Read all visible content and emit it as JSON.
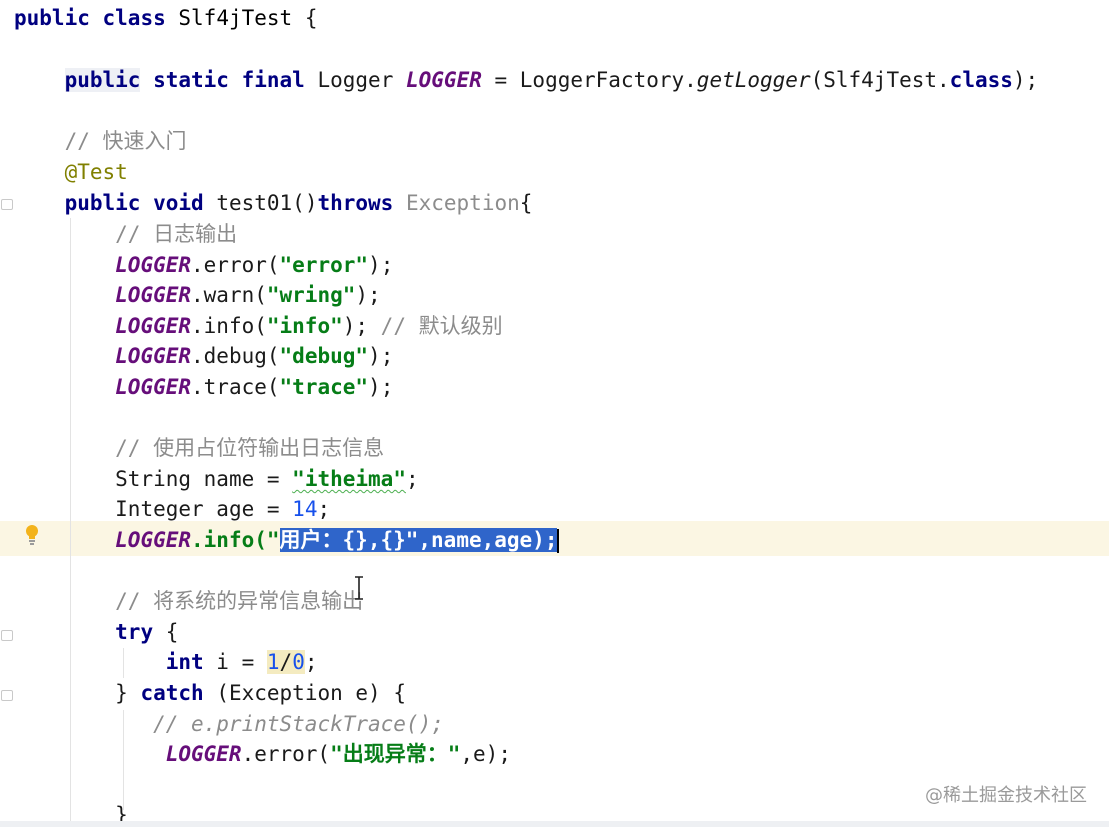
{
  "editor": {
    "class_decl": {
      "kw1": "public",
      "kw2": "class",
      "name": "Slf4jTest",
      "brace": " {"
    },
    "logger_decl": {
      "kw_public": "public",
      "kw_static": "static",
      "kw_final": "final",
      "type": "Logger",
      "field": "LOGGER",
      "assign": " = LoggerFactory.",
      "method": "getLogger",
      "args_open": "(Slf4jTest.",
      "kw_class": "class",
      "args_close": ");"
    },
    "comment_quickstart": "// 快速入门",
    "annotation": "@Test",
    "method_decl": {
      "kw_public": "public",
      "kw_void": "void",
      "name": " test01()",
      "kw_throws": "throws",
      "exception": " Exception",
      "brace": "{"
    },
    "comment_log_output": "// 日志输出",
    "log_calls": [
      {
        "field": "LOGGER",
        "call": ".error(",
        "arg": "\"error\"",
        "end": ");",
        "comment": ""
      },
      {
        "field": "LOGGER",
        "call": ".warn(",
        "arg": "\"wring\"",
        "end": ");",
        "comment": ""
      },
      {
        "field": "LOGGER",
        "call": ".info(",
        "arg": "\"info\"",
        "end": ");",
        "comment": " // 默认级别"
      },
      {
        "field": "LOGGER",
        "call": ".debug(",
        "arg": "\"debug\"",
        "end": ");",
        "comment": ""
      },
      {
        "field": "LOGGER",
        "call": ".trace(",
        "arg": "\"trace\"",
        "end": ");",
        "comment": ""
      }
    ],
    "comment_placeholder": "// 使用占位符输出日志信息",
    "name_decl": {
      "type_name": "String name = ",
      "value": "\"itheima\"",
      "end": ";"
    },
    "age_decl": {
      "type_name": "Integer age = ",
      "value": "14",
      "end": ";"
    },
    "current_line": {
      "field": "LOGGER",
      "call": ".info(\"",
      "selected": "用户：{},{}\",name,age);"
    },
    "comment_exception": "// 将系统的异常信息输出",
    "try_block": {
      "kw_try": "try",
      "brace": " {"
    },
    "int_line": {
      "kw_int": "int",
      "var": " i = ",
      "n1": "1",
      "slash": "/",
      "n2": "0",
      "end": ";"
    },
    "catch_line": {
      "close": "} ",
      "kw_catch": "catch",
      "params": " (Exception e) {"
    },
    "commented_print": "// e.printStackTrace();",
    "error_line": {
      "field": "LOGGER",
      "call": ".error(",
      "arg": "\"出现异常：\"",
      "end": ",e);"
    },
    "closing_brace": "}"
  },
  "watermark": "@稀土掘金技术社区",
  "icons": {
    "gutter": "lightbulb-icon",
    "cursor": "text-cursor-icon"
  },
  "colors": {
    "keyword": "#000080",
    "field": "#660e7a",
    "string": "#067d17",
    "number": "#1750eb",
    "comment": "#8c8c8c",
    "annotation": "#808000",
    "selection": "#2f65ca",
    "current_line": "#fbf6e3"
  }
}
